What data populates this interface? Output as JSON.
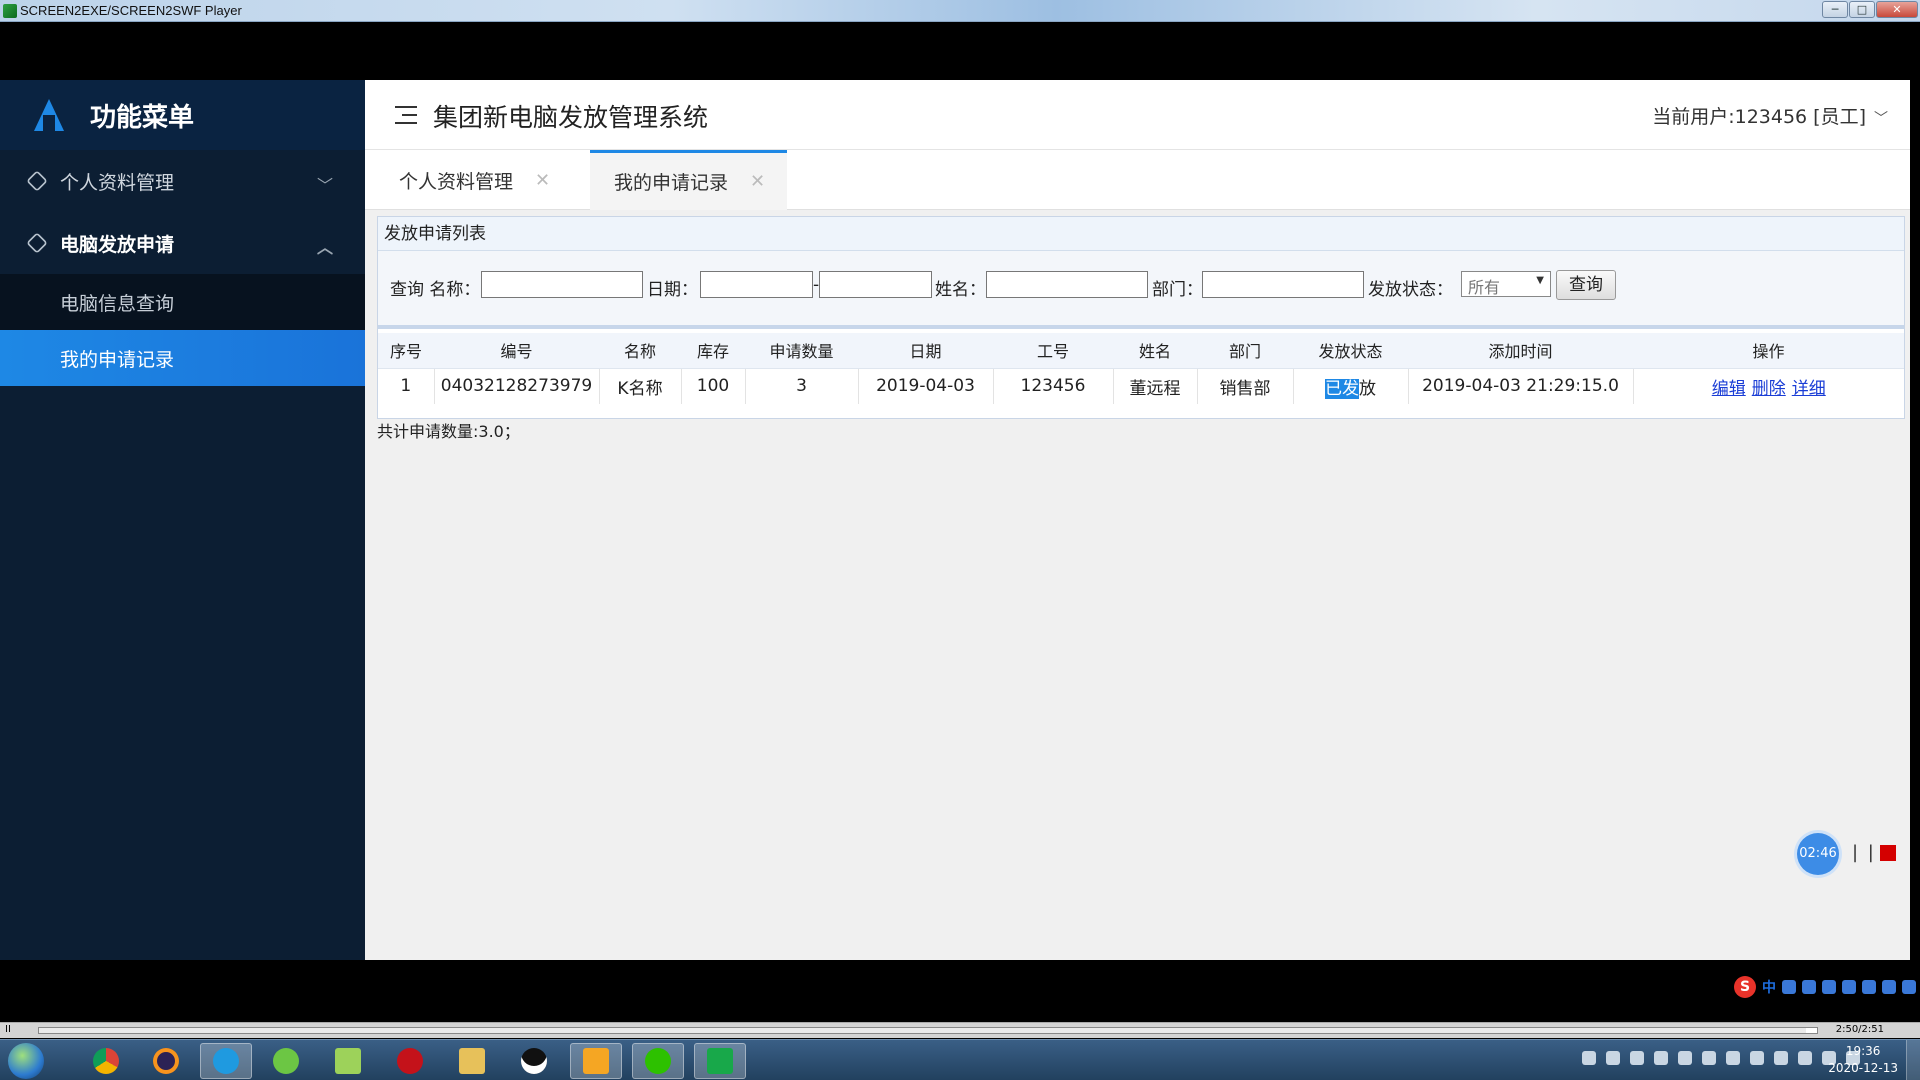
{
  "window": {
    "title": "SCREEN2EXE/SCREEN2SWF Player",
    "min": "─",
    "max": "□",
    "close": "✕"
  },
  "sidebar": {
    "title": "功能菜单",
    "groups": [
      {
        "label": "个人资料管理",
        "chevron": "﹀"
      },
      {
        "label": "电脑发放申请",
        "chevron": "︿"
      }
    ],
    "items": [
      {
        "label": "电脑信息查询"
      },
      {
        "label": "我的申请记录"
      }
    ]
  },
  "header": {
    "system_title": "集团新电脑发放管理系统",
    "current_user": "当前用户:123456 [员工]",
    "user_chevron": "﹀"
  },
  "tabs": [
    {
      "label": "个人资料管理",
      "close": "✕"
    },
    {
      "label": "我的申请记录",
      "close": "✕"
    }
  ],
  "panel": {
    "title": "发放申请列表",
    "filter": {
      "query_label": "查询 名称：",
      "date_label": "日期：",
      "date_sep": "-",
      "name_label": "姓名：",
      "dept_label": "部门：",
      "status_label": "发放状态：",
      "status_value": "所有",
      "search_button": "查询"
    },
    "columns": [
      "序号",
      "编号",
      "名称",
      "库存",
      "申请数量",
      "日期",
      "工号",
      "姓名",
      "部门",
      "发放状态",
      "添加时间",
      "操作"
    ],
    "rows": [
      {
        "seq": "1",
        "code": "04032128273979",
        "name": "K名称",
        "stock": "100",
        "qty": "3",
        "date": "2019-04-03",
        "emp_no": "123456",
        "person": "董远程",
        "dept": "销售部",
        "status_hl": "已发",
        "status_rest": "放",
        "added": "2019-04-03 21:29:15.0",
        "op_edit": "编辑",
        "op_delete": "删除",
        "op_detail": "详细"
      }
    ],
    "summary": "共计申请数量:3.0；"
  },
  "recorder": {
    "timer": "02:46",
    "pause": "| |"
  },
  "ime": {
    "logo": "S",
    "mode": "中"
  },
  "player": {
    "pause": "II",
    "time": "2:50/2:51",
    "progress": 0.994
  },
  "clock": {
    "time": "19:36",
    "date": "2020-12-13"
  },
  "colors": {
    "accent": "#1e88e5",
    "sidebar_bg": "#0c1e33",
    "link": "#1a3dd6"
  }
}
